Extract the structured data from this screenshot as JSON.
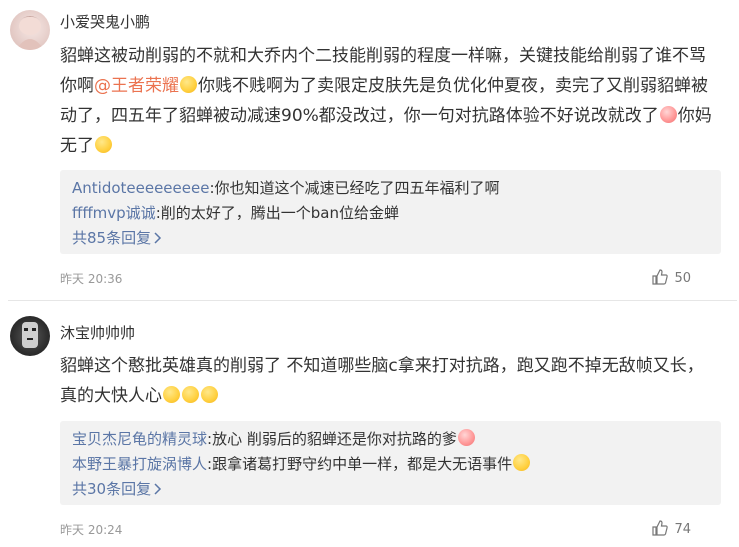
{
  "comments": [
    {
      "username": "小爱哭鬼小鹏",
      "text_a": "貂蝉这被动削弱的不就和大乔内个二技能削弱的程度一样嘛，关键技能给削弱了谁不骂你啊",
      "mention": "@王者荣耀",
      "text_b": "你贱不贱啊为了卖限定皮肤先是负优化仲夏夜，卖完了又削弱貂蝉被动了，四五年了貂蝉被动减速90%都没改过，你一句对抗路体验不好说改就改了",
      "text_c": "你妈无了",
      "replies": [
        {
          "user": "Antidoteeeeeeeee",
          "text": ":你也知道这个减速已经吃了四五年福利了啊"
        },
        {
          "user": "ffffmvp诚诚",
          "text": ":削的太好了，腾出一个ban位给金蝉"
        }
      ],
      "more_replies": "共85条回复",
      "time": "昨天 20:36",
      "likes": "50"
    },
    {
      "username": "沐宝帅帅帅",
      "text_a": "貂蝉这个憨批英雄真的削弱了 不知道哪些脑c拿来打对抗路，跑又跑不掉无敌帧又长， 真的大快人心",
      "replies": [
        {
          "user": "宝贝杰尼龟的精灵球",
          "text": ":放心 削弱后的貂蝉还是你对抗路的爹"
        },
        {
          "user": "本野王暴打旋涡博人",
          "text": ":跟拿诸葛打野守约中单一样，都是大无语事件"
        }
      ],
      "more_replies": "共30条回复",
      "time": "昨天 20:24",
      "likes": "74"
    }
  ],
  "icons": {
    "more": "chevron-right-icon",
    "like": "thumbs-up-icon"
  }
}
